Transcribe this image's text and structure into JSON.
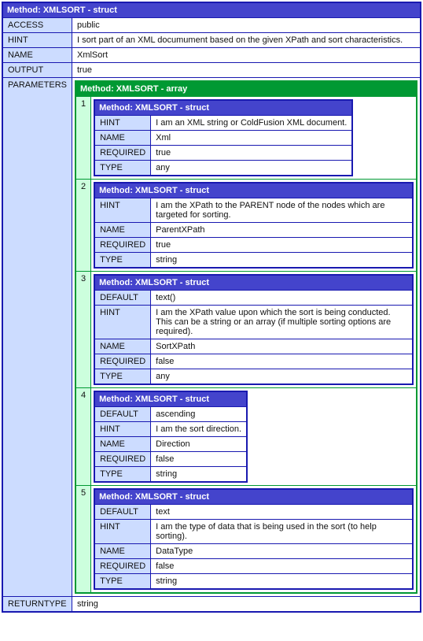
{
  "outer": {
    "header": "Method: XMLSORT - struct",
    "rows": {
      "access": {
        "key": "ACCESS",
        "value": "public"
      },
      "hint": {
        "key": "HINT",
        "value": "I sort part of an XML documument based on the given XPath and sort characteristics."
      },
      "name": {
        "key": "NAME",
        "value": "XmlSort"
      },
      "output": {
        "key": "OUTPUT",
        "value": "true"
      },
      "parameters": {
        "key": "PARAMETERS"
      },
      "returntype": {
        "key": "RETURNTYPE",
        "value": "string"
      }
    }
  },
  "array": {
    "header": "Method: XMLSORT - array",
    "items": [
      {
        "index": "1",
        "header": "Method: XMLSORT - struct",
        "rows": [
          {
            "key": "HINT",
            "value": "I am an XML string or ColdFusion XML document."
          },
          {
            "key": "NAME",
            "value": "Xml"
          },
          {
            "key": "REQUIRED",
            "value": "true"
          },
          {
            "key": "TYPE",
            "value": "any"
          }
        ]
      },
      {
        "index": "2",
        "header": "Method: XMLSORT - struct",
        "rows": [
          {
            "key": "HINT",
            "value": "I am the XPath to the PARENT node of the nodes which are targeted for sorting."
          },
          {
            "key": "NAME",
            "value": "ParentXPath"
          },
          {
            "key": "REQUIRED",
            "value": "true"
          },
          {
            "key": "TYPE",
            "value": "string"
          }
        ]
      },
      {
        "index": "3",
        "header": "Method: XMLSORT - struct",
        "rows": [
          {
            "key": "DEFAULT",
            "value": "text()"
          },
          {
            "key": "HINT",
            "value": "I am the XPath value upon which the sort is being conducted. This can be a string or an array (if multiple sorting options are required)."
          },
          {
            "key": "NAME",
            "value": "SortXPath"
          },
          {
            "key": "REQUIRED",
            "value": "false"
          },
          {
            "key": "TYPE",
            "value": "any"
          }
        ]
      },
      {
        "index": "4",
        "header": "Method: XMLSORT - struct",
        "rows": [
          {
            "key": "DEFAULT",
            "value": "ascending"
          },
          {
            "key": "HINT",
            "value": "I am the sort direction."
          },
          {
            "key": "NAME",
            "value": "Direction"
          },
          {
            "key": "REQUIRED",
            "value": "false"
          },
          {
            "key": "TYPE",
            "value": "string"
          }
        ]
      },
      {
        "index": "5",
        "header": "Method: XMLSORT - struct",
        "rows": [
          {
            "key": "DEFAULT",
            "value": "text"
          },
          {
            "key": "HINT",
            "value": "I am the type of data that is being used in the sort (to help sorting)."
          },
          {
            "key": "NAME",
            "value": "DataType"
          },
          {
            "key": "REQUIRED",
            "value": "false"
          },
          {
            "key": "TYPE",
            "value": "string"
          }
        ]
      }
    ]
  }
}
